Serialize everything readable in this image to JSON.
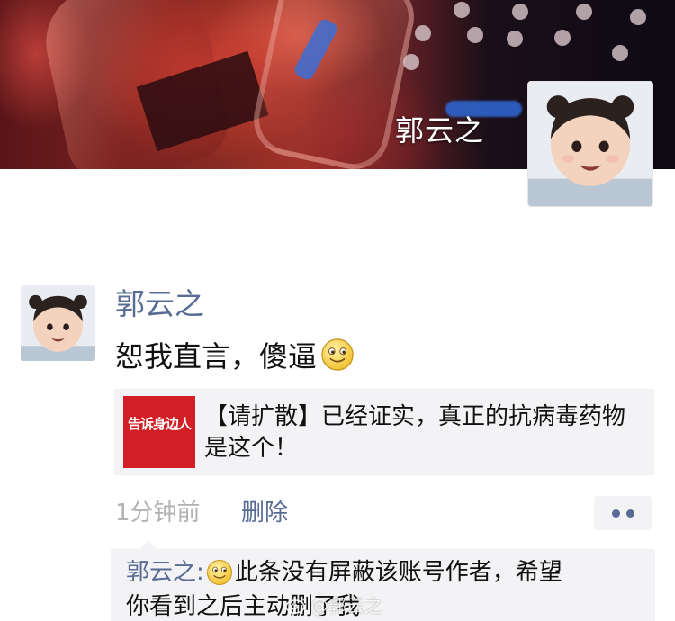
{
  "cover": {
    "username": "郭云之"
  },
  "post": {
    "author": "郭云之",
    "text": "恕我直言，傻逼",
    "emoji": "smile-emoji",
    "link": {
      "thumbnail_text": "告诉身边人",
      "title": "【请扩散】已经证实，真正的抗病毒药物是这个！"
    },
    "time": "1分钟前",
    "delete_label": "删除",
    "more_icon": "more-dots-icon"
  },
  "comment": {
    "author": "郭云之",
    "separator": ":",
    "line1_text": "此条没有屏蔽该账号作者，希望",
    "line2_text": "你看到之后主动删了我",
    "emoji": "smile-emoji"
  },
  "watermark": {
    "text": "@郭云之"
  },
  "colors": {
    "link_blue": "#576b95",
    "meta_gray": "#b2b2b2",
    "card_bg": "#f3f3f5",
    "thumb_red": "#d11f25"
  }
}
